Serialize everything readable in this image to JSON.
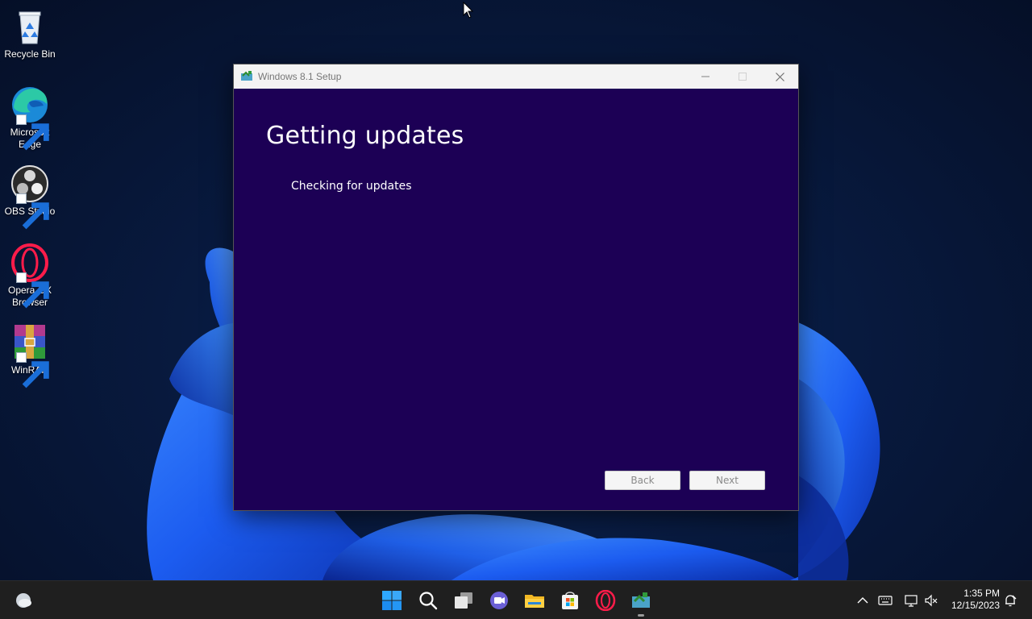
{
  "desktop": {
    "icons": [
      {
        "label": "Recycle Bin",
        "icon": "recycle-bin-icon"
      },
      {
        "label": "Microsoft Edge",
        "icon": "edge-icon"
      },
      {
        "label": "OBS Studio",
        "icon": "obs-icon"
      },
      {
        "label": "Opera GX Browser",
        "icon": "opera-gx-icon"
      },
      {
        "label": "WinRAR",
        "icon": "winrar-icon"
      }
    ]
  },
  "setup_window": {
    "title": "Windows 8.1 Setup",
    "heading": "Getting updates",
    "status": "Checking for updates",
    "back_label": "Back",
    "next_label": "Next",
    "background_color": "#1c0055"
  },
  "taskbar": {
    "pinned": [
      "weather-icon",
      "start-icon",
      "search-icon",
      "task-view-icon",
      "chat-icon",
      "file-explorer-icon",
      "microsoft-store-icon",
      "opera-gx-icon",
      "windows-setup-icon"
    ],
    "tray": [
      "chevron-up-icon",
      "keyboard-icon",
      "network-icon",
      "volume-muted-icon",
      "notification-icon"
    ],
    "time": "1:35 PM",
    "date": "12/15/2023"
  },
  "colors": {
    "accent": "#0078d4",
    "wallpaper_dark": "#081a3f",
    "taskbar": "#1f1f1f"
  }
}
